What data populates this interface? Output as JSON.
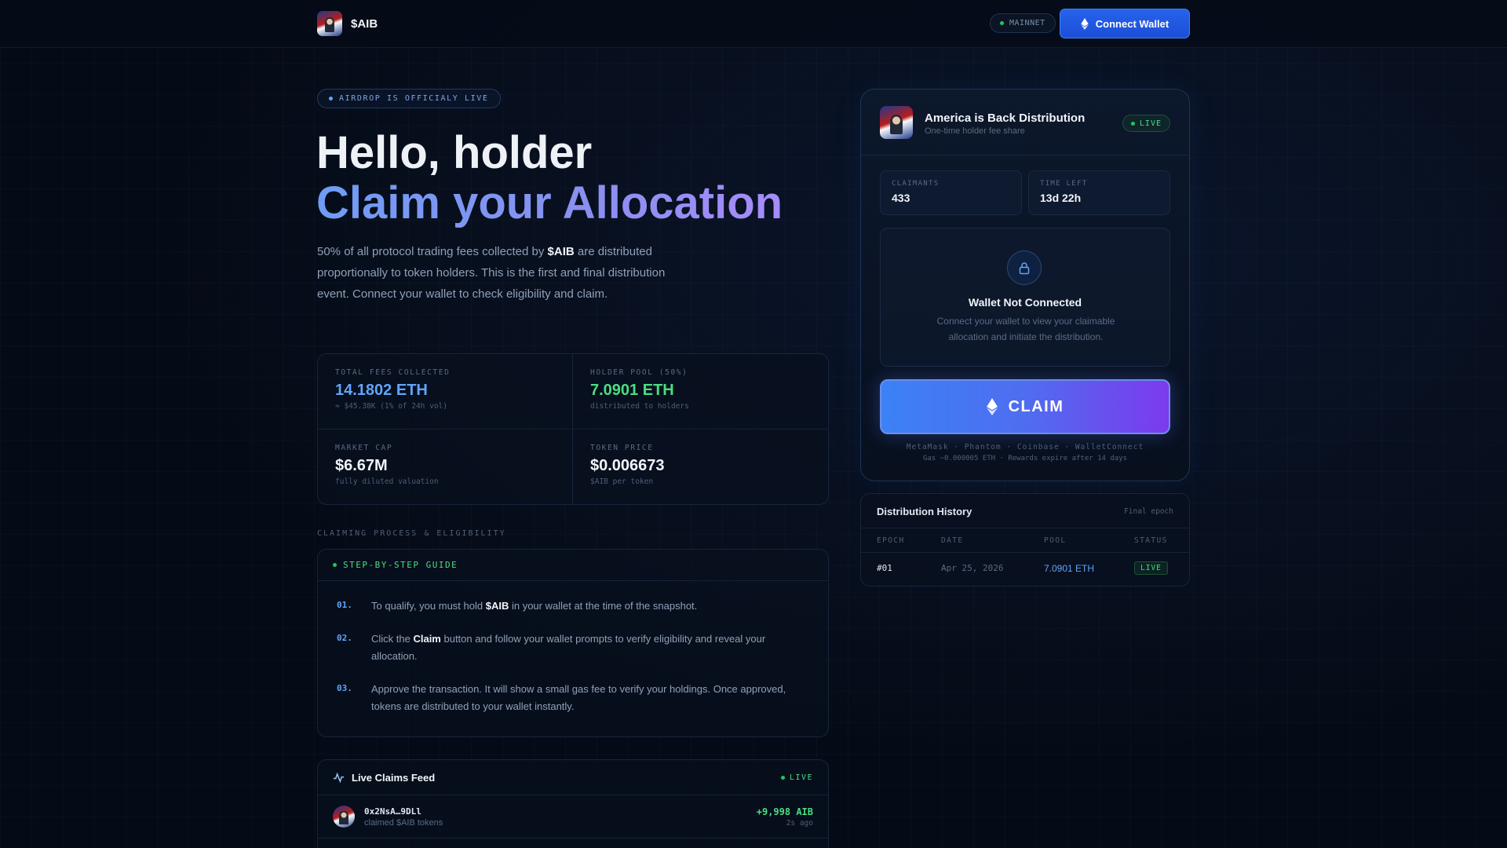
{
  "header": {
    "brand": "$AIB",
    "network": "MAINNET",
    "connect_label": "Connect Wallet"
  },
  "hero": {
    "pill": "AIRDROP IS OFFICIALY LIVE",
    "title_line1": "Hello, holder",
    "title_line2": "Claim your Allocation",
    "lead_before": "50% of all protocol trading fees collected by ",
    "lead_token": "$AIB",
    "lead_after": " are distributed proportionally to token holders. This is the first and final distribution event. Connect your wallet to check eligibility and claim."
  },
  "stats": [
    {
      "label": "TOTAL FEES COLLECTED",
      "value": "14.1802 ETH",
      "sub": "≈ $45.38K (1% of 24h vol)"
    },
    {
      "label": "HOLDER POOL (50%)",
      "value": "7.0901 ETH",
      "sub": "distributed to holders"
    },
    {
      "label": "MARKET CAP",
      "value": "$6.67M",
      "sub": "fully diluted valuation"
    },
    {
      "label": "TOKEN PRICE",
      "value": "$0.006673",
      "sub": "$AIB per token"
    }
  ],
  "guide": {
    "section_label": "CLAIMING PROCESS & ELIGIBILITY",
    "header": "STEP-BY-STEP GUIDE",
    "steps": [
      {
        "num": "01.",
        "before": "To qualify, you must hold ",
        "bold": "$AIB",
        "after": " in your wallet at the time of the snapshot."
      },
      {
        "num": "02.",
        "before": "Click the ",
        "bold": "Claim",
        "after": " button and follow your wallet prompts to verify eligibility and reveal your allocation."
      },
      {
        "num": "03.",
        "before": "Approve the transaction. It will show a small gas fee to verify your holdings. Once approved, tokens are distributed to your wallet instantly.",
        "bold": "",
        "after": ""
      }
    ]
  },
  "feed": {
    "title": "Live Claims Feed",
    "live": "LIVE",
    "rows": [
      {
        "address": "0x2NsA…9DLl",
        "desc": "claimed $AIB tokens",
        "amount": "+9,998 AIB",
        "time": "2s ago"
      }
    ]
  },
  "card": {
    "title": "America is Back Distribution",
    "subtitle": "One-time holder fee share",
    "live": "LIVE",
    "claimants_label": "CLAIMANTS",
    "claimants_value": "433",
    "time_label": "TIME LEFT",
    "time_value": "13d 22h",
    "wallet_title": "Wallet Not Connected",
    "wallet_desc": "Connect your wallet to view your claimable allocation and initiate the distribution.",
    "claim_label": "CLAIM",
    "providers": "MetaMask · Phantom · Coinbase · WalletConnect",
    "gas": "Gas ~0.000005 ETH  ·  Rewards expire after 14 days"
  },
  "history": {
    "title": "Distribution History",
    "note": "Final epoch",
    "columns": [
      "EPOCH",
      "DATE",
      "POOL",
      "STATUS"
    ],
    "rows": [
      {
        "epoch": "#01",
        "date": "Apr 25, 2026",
        "pool": "7.0901 ETH",
        "status": "LIVE"
      }
    ]
  },
  "colors": {
    "accent_blue": "#60a5fa",
    "accent_green": "#4ade80",
    "accent_purple": "#7c3aed",
    "background": "#050b16"
  }
}
